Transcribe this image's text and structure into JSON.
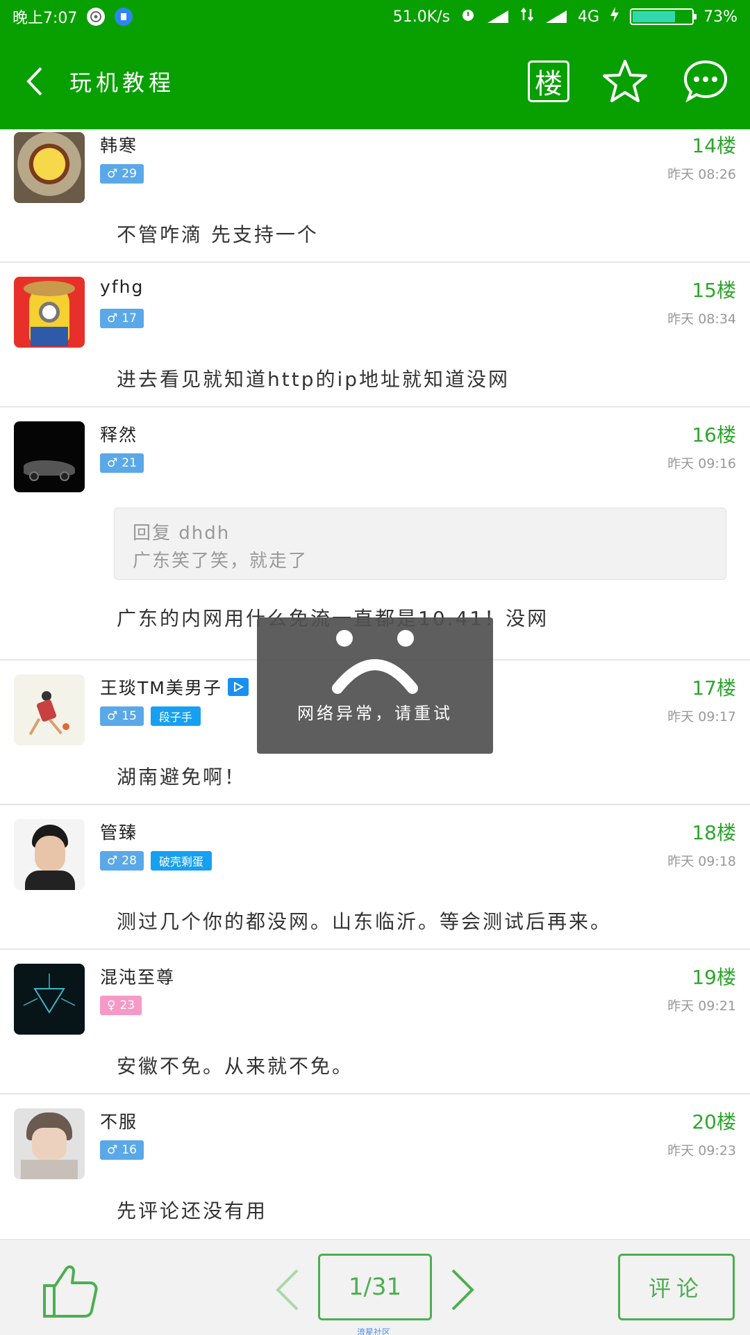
{
  "status_bar": {
    "time": "晚上7:07",
    "net_speed": "51.0K/s",
    "network": "4G",
    "battery_percent": "73%",
    "battery_level": 0.73
  },
  "header": {
    "title": "玩机教程",
    "floor_label": "楼",
    "accent_color": "#08a000"
  },
  "posts": [
    {
      "username": "韩寒",
      "gender": "♂",
      "level": "29",
      "badge": "",
      "floor": "14楼",
      "time": "昨天 08:26",
      "content": "不管咋滴  先支持一个"
    },
    {
      "username": "yfhg",
      "gender": "♂",
      "level": "17",
      "badge": "",
      "floor": "15楼",
      "time": "昨天 08:34",
      "content": "进去看见就知道http的ip地址就知道没网"
    },
    {
      "username": "释然",
      "gender": "♂",
      "level": "21",
      "badge": "",
      "floor": "16楼",
      "time": "昨天 09:16",
      "quote_title": "回复 dhdh",
      "quote_text": "广东笑了笑，就走了",
      "content": "广东的内网用什么免流一直都是10.41！没网"
    },
    {
      "username": "王琰TM美男子",
      "gender": "♂",
      "level": "15",
      "badge": "段子手",
      "floor": "17楼",
      "time": "昨天 09:17",
      "content": "湖南避免啊！"
    },
    {
      "username": "管臻",
      "gender": "♂",
      "level": "28",
      "badge": "破壳剩蛋",
      "floor": "18楼",
      "time": "昨天 09:18",
      "content": "测过几个你的都没网。山东临沂。等会测试后再来。"
    },
    {
      "username": "混沌至尊",
      "gender": "♀",
      "level": "23",
      "badge": "",
      "floor": "19楼",
      "time": "昨天 09:21",
      "content": "安徽不免。从来就不免。"
    },
    {
      "username": "不服",
      "gender": "♂",
      "level": "16",
      "badge": "",
      "floor": "20楼",
      "time": "昨天 09:23",
      "content": "先评论还没有用"
    }
  ],
  "toast": {
    "message": "网络异常，请重试"
  },
  "bottom_bar": {
    "page": "1/31",
    "comment_label": "评论",
    "footer_label": "流星社区"
  }
}
